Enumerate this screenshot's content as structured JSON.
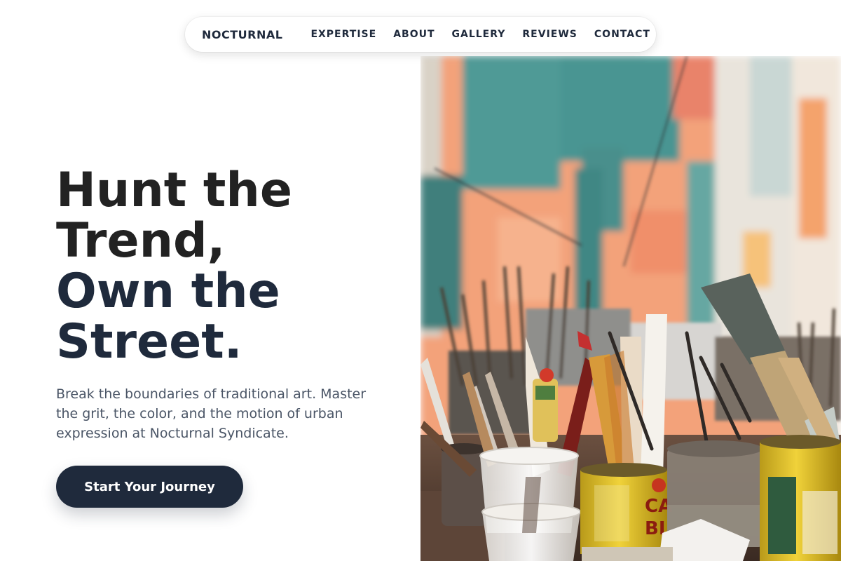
{
  "nav": {
    "brand": "NOCTURNAL",
    "links": [
      "EXPERTISE",
      "ABOUT",
      "GALLERY",
      "REVIEWS",
      "CONTACT"
    ]
  },
  "hero": {
    "title_lines": [
      "Hunt the",
      "Trend,",
      "Own the",
      "Street."
    ],
    "subtitle": "Break the boundaries of traditional art. Master the grit, the color, and the motion of urban expression at Nocturnal Syndicate.",
    "cta_label": "Start Your Journey",
    "image": "art-studio-brushes-photo"
  },
  "colors": {
    "primary_dark": "#1f2a3c",
    "heading": "#222222",
    "body_text": "#4a5566",
    "mural_teal": "#4f9a96",
    "mural_orange": "#f3a27a"
  }
}
